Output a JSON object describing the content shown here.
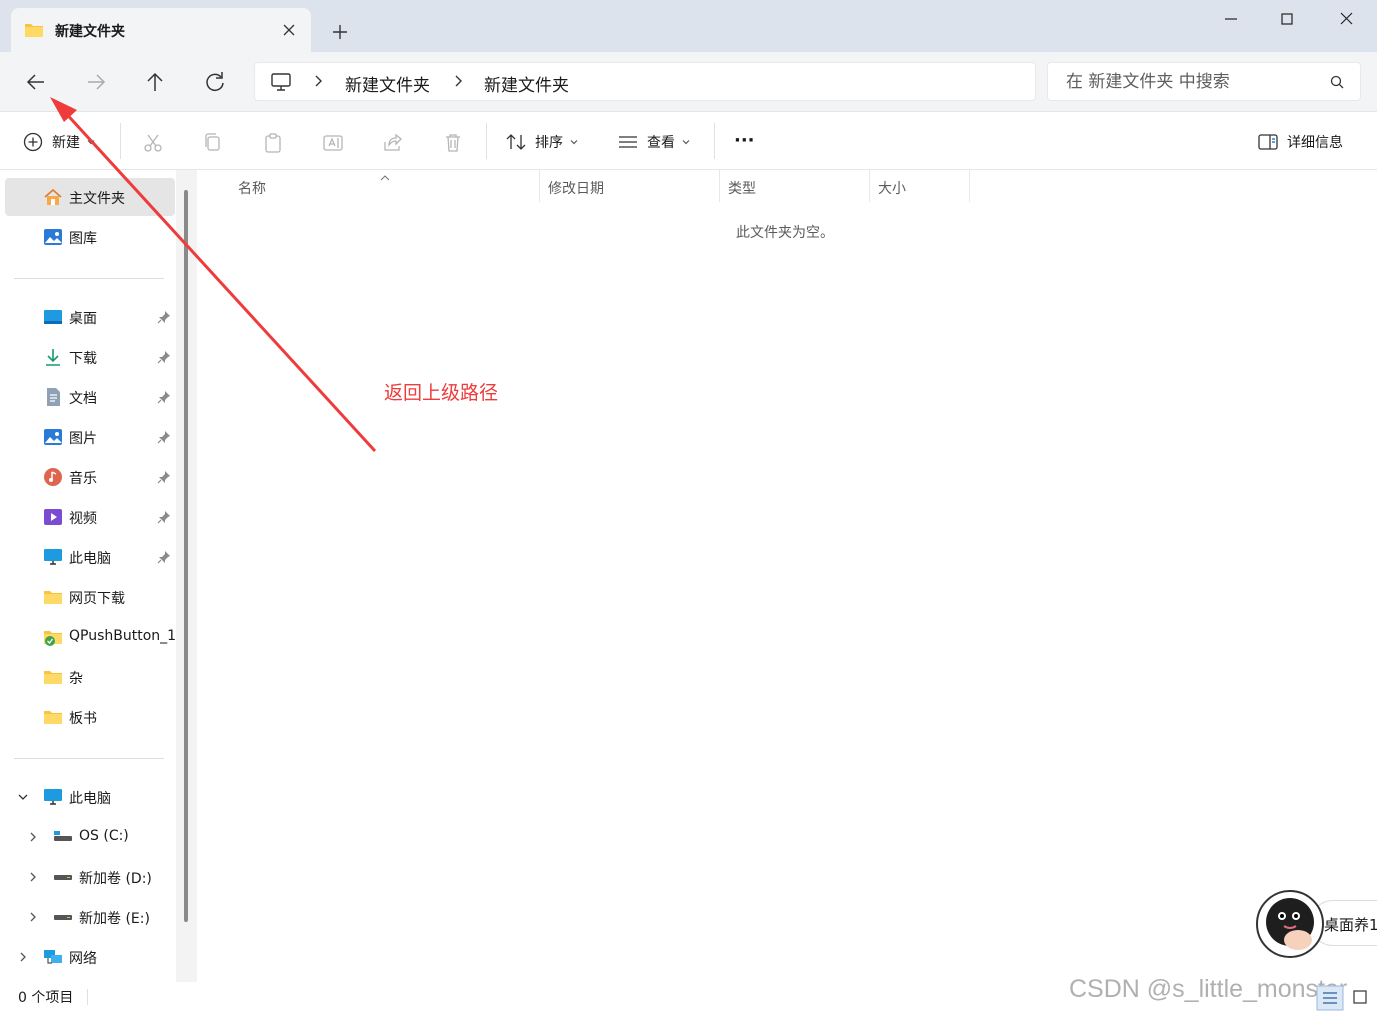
{
  "window": {
    "tab_title": "新建文件夹",
    "tab_close_icon": "close-icon",
    "new_tab_icon": "plus-icon",
    "controls": [
      "minimize-icon",
      "maximize-icon",
      "close-icon"
    ]
  },
  "nav": {
    "back_icon": "arrow-left-icon",
    "forward_icon": "arrow-right-icon",
    "up_icon": "arrow-up-icon",
    "refresh_icon": "refresh-icon",
    "breadcrumb": [
      "新建文件夹",
      "新建文件夹"
    ],
    "search_placeholder": "在 新建文件夹 中搜索"
  },
  "toolbar": {
    "new_label": "新建",
    "sort_label": "排序",
    "view_label": "查看",
    "more_label": "···",
    "details_label": "详细信息",
    "icons": [
      "cut-icon",
      "copy-icon",
      "paste-icon",
      "rename-icon",
      "share-icon",
      "delete-icon"
    ]
  },
  "sidebar": {
    "top": [
      {
        "label": "主文件夹",
        "icon": "home-icon"
      },
      {
        "label": "图库",
        "icon": "gallery-icon"
      }
    ],
    "quick": [
      {
        "label": "桌面",
        "icon": "desktop-icon"
      },
      {
        "label": "下载",
        "icon": "download-icon"
      },
      {
        "label": "文档",
        "icon": "documents-icon"
      },
      {
        "label": "图片",
        "icon": "pictures-icon"
      },
      {
        "label": "音乐",
        "icon": "music-icon"
      },
      {
        "label": "视频",
        "icon": "video-icon"
      },
      {
        "label": "此电脑",
        "icon": "computer-icon"
      },
      {
        "label": "网页下载",
        "icon": "folder-icon"
      },
      {
        "label": "QPushButton_1",
        "icon": "folder-sync-icon"
      },
      {
        "label": "杂",
        "icon": "folder-icon"
      },
      {
        "label": "板书",
        "icon": "folder-icon"
      }
    ],
    "this_pc": "此电脑",
    "drives": [
      "OS (C:)",
      "新加卷 (D:)",
      "新加卷 (E:)"
    ],
    "network": "网络"
  },
  "columns": [
    "名称",
    "修改日期",
    "类型",
    "大小"
  ],
  "empty_text": "此文件夹为空。",
  "annotation": "返回上级路径",
  "status": {
    "count": "0 个项目"
  },
  "widget_text": "桌面养1",
  "watermark": "CSDN @s_little_monster",
  "colors": {
    "accent": "#0067c0",
    "annotation": "#ee3b3b",
    "folder": "#f6c343"
  }
}
